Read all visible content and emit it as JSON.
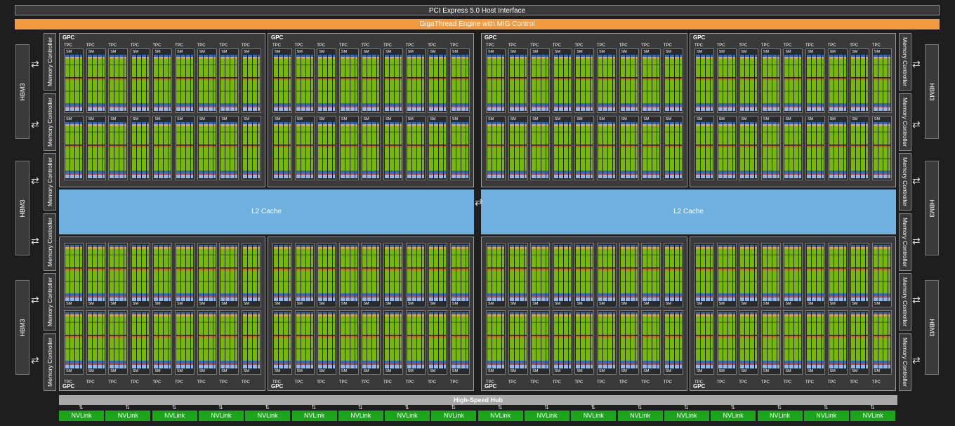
{
  "header": {
    "pcie": "PCI Express 5.0 Host Interface",
    "gigathread": "GigaThread Engine with MIG Control"
  },
  "memory": {
    "hbm_label": "HBM3",
    "memory_controller_label": "Memory Controller"
  },
  "gpc_label": "GPC",
  "tpc_label": "TPC",
  "sm_label": "SM",
  "l2_cache": [
    "L2 Cache",
    "L2 Cache"
  ],
  "hub": "High-Speed Hub",
  "nvlink": [
    "NVLink",
    "NVLink",
    "NVLink",
    "NVLink",
    "NVLink",
    "NVLink",
    "NVLink",
    "NVLink",
    "NVLink",
    "NVLink",
    "NVLink",
    "NVLink",
    "NVLink",
    "NVLink",
    "NVLink",
    "NVLink",
    "NVLink",
    "NVLink"
  ],
  "colors": {
    "gigathread": "#f39a3e",
    "l2": "#6fb0de",
    "nvlink": "#1aa51a",
    "sm_cores": "#76b900"
  }
}
